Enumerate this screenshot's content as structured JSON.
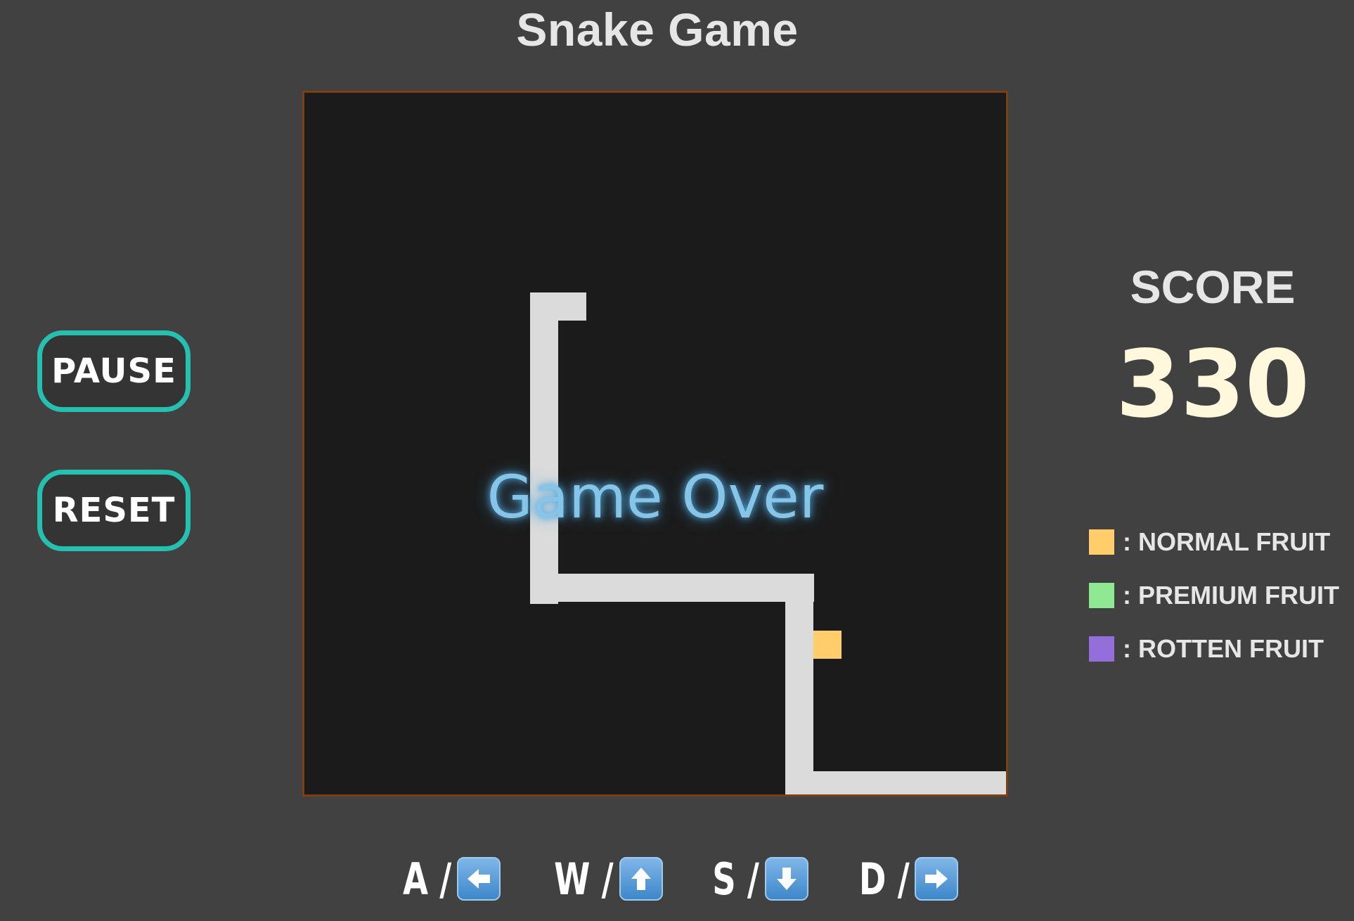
{
  "title": "Snake Game",
  "board": {
    "status_text": "Game Over",
    "snake_color": "#dbdbdb",
    "background_color": "#1b1b1b",
    "border_color": "#7a3f15"
  },
  "controls": {
    "pause_label": "PAUSE",
    "reset_label": "RESET",
    "accent_color": "#26c0b0"
  },
  "score": {
    "label": "SCORE",
    "value": "330"
  },
  "legend": [
    {
      "label": ": NORMAL FRUIT",
      "color": "#ffcd6a"
    },
    {
      "label": ": PREMIUM FRUIT",
      "color": "#8fe892"
    },
    {
      "label": ": ROTTEN FRUIT",
      "color": "#946fdb"
    }
  ],
  "keys": [
    {
      "letter": "A /",
      "icon": "left-arrow-icon"
    },
    {
      "letter": "W /",
      "icon": "up-arrow-icon"
    },
    {
      "letter": "S /",
      "icon": "down-arrow-icon"
    },
    {
      "letter": "D /",
      "icon": "right-arrow-icon"
    }
  ]
}
